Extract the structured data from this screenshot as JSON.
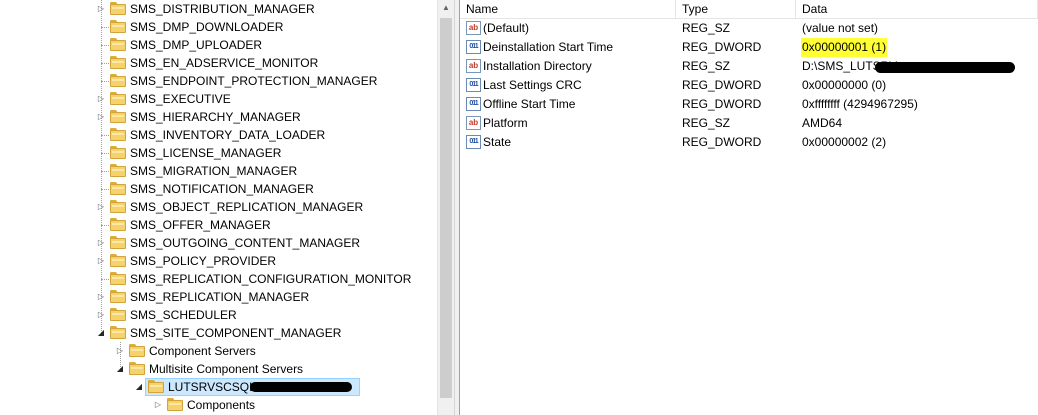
{
  "tree": {
    "items": [
      {
        "label": "SMS_DISTRIBUTION_MANAGER",
        "level": 0,
        "expander": "collapsed"
      },
      {
        "label": "SMS_DMP_DOWNLOADER",
        "level": 0,
        "expander": "none"
      },
      {
        "label": "SMS_DMP_UPLOADER",
        "level": 0,
        "expander": "none"
      },
      {
        "label": "SMS_EN_ADSERVICE_MONITOR",
        "level": 0,
        "expander": "none"
      },
      {
        "label": "SMS_ENDPOINT_PROTECTION_MANAGER",
        "level": 0,
        "expander": "none"
      },
      {
        "label": "SMS_EXECUTIVE",
        "level": 0,
        "expander": "collapsed"
      },
      {
        "label": "SMS_HIERARCHY_MANAGER",
        "level": 0,
        "expander": "collapsed"
      },
      {
        "label": "SMS_INVENTORY_DATA_LOADER",
        "level": 0,
        "expander": "none"
      },
      {
        "label": "SMS_LICENSE_MANAGER",
        "level": 0,
        "expander": "none"
      },
      {
        "label": "SMS_MIGRATION_MANAGER",
        "level": 0,
        "expander": "none"
      },
      {
        "label": "SMS_NOTIFICATION_MANAGER",
        "level": 0,
        "expander": "none"
      },
      {
        "label": "SMS_OBJECT_REPLICATION_MANAGER",
        "level": 0,
        "expander": "collapsed"
      },
      {
        "label": "SMS_OFFER_MANAGER",
        "level": 0,
        "expander": "none"
      },
      {
        "label": "SMS_OUTGOING_CONTENT_MANAGER",
        "level": 0,
        "expander": "collapsed"
      },
      {
        "label": "SMS_POLICY_PROVIDER",
        "level": 0,
        "expander": "collapsed"
      },
      {
        "label": "SMS_REPLICATION_CONFIGURATION_MONITOR",
        "level": 0,
        "expander": "none"
      },
      {
        "label": "SMS_REPLICATION_MANAGER",
        "level": 0,
        "expander": "collapsed"
      },
      {
        "label": "SMS_SCHEDULER",
        "level": 0,
        "expander": "collapsed"
      },
      {
        "label": "SMS_SITE_COMPONENT_MANAGER",
        "level": 0,
        "expander": "expanded"
      },
      {
        "label": "Component Servers",
        "level": 1,
        "expander": "collapsed"
      },
      {
        "label": "Multisite Component Servers",
        "level": 1,
        "expander": "expanded"
      },
      {
        "label": "LUTSRVSCSQL",
        "level": 2,
        "expander": "expanded",
        "selected": true,
        "redacted": true
      },
      {
        "label": "Components",
        "level": 3,
        "expander": "collapsed"
      }
    ]
  },
  "values": {
    "columns": {
      "name": "Name",
      "type": "Type",
      "data": "Data"
    },
    "rows": [
      {
        "icon": "string-value-icon",
        "glyph": "ab",
        "name": "(Default)",
        "type": "REG_SZ",
        "data": "(value not set)"
      },
      {
        "icon": "dword-value-icon",
        "glyph": "011",
        "name": "Deinstallation Start Time",
        "type": "REG_DWORD",
        "data": "0x00000001 (1)",
        "highlight": true
      },
      {
        "icon": "string-value-icon",
        "glyph": "ab",
        "name": "Installation Directory",
        "type": "REG_SZ",
        "data": "D:\\SMS_LUTSRV",
        "redacted": true
      },
      {
        "icon": "dword-value-icon",
        "glyph": "011",
        "name": "Last Settings CRC",
        "type": "REG_DWORD",
        "data": "0x00000000 (0)"
      },
      {
        "icon": "dword-value-icon",
        "glyph": "011",
        "name": "Offline Start Time",
        "type": "REG_DWORD",
        "data": "0xffffffff (4294967295)"
      },
      {
        "icon": "string-value-icon",
        "glyph": "ab",
        "name": "Platform",
        "type": "REG_SZ",
        "data": "AMD64"
      },
      {
        "icon": "dword-value-icon",
        "glyph": "011",
        "name": "State",
        "type": "REG_DWORD",
        "data": "0x00000002 (2)"
      }
    ]
  },
  "colors": {
    "selection": "#cce8ff",
    "highlight": "#ffff33",
    "folder": "#f5d26b"
  }
}
